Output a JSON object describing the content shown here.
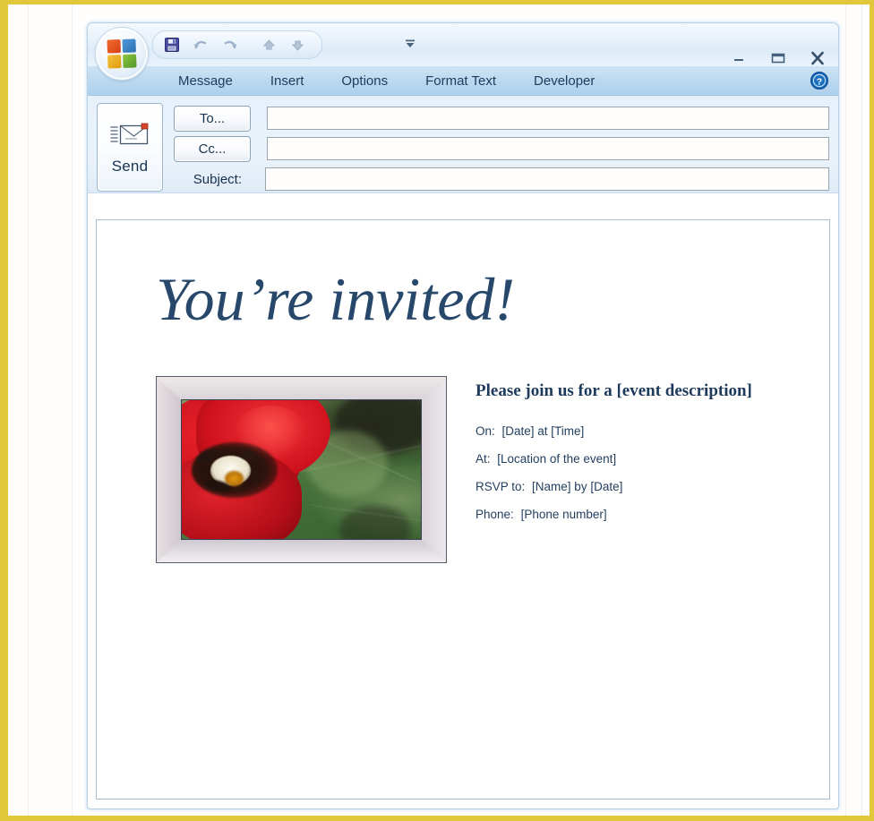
{
  "window": {
    "orb_icon": "office-orb-icon",
    "quick_access": [
      {
        "name": "save-button",
        "icon": "save-floppy-icon",
        "label": "Save"
      },
      {
        "name": "undo-button",
        "icon": "undo-arrow-icon",
        "label": "Undo"
      },
      {
        "name": "redo-button",
        "icon": "redo-arrow-icon",
        "label": "Redo"
      },
      {
        "name": "previous-item-button",
        "icon": "up-arrow-icon",
        "label": "Previous Item"
      },
      {
        "name": "next-item-button",
        "icon": "down-arrow-icon",
        "label": "Next Item"
      }
    ],
    "qat_dropdown_icon": "chevron-down-icon",
    "controls": [
      {
        "name": "minimize-button",
        "icon": "minimize-icon",
        "label": "Minimize"
      },
      {
        "name": "maximize-button",
        "icon": "maximize-icon",
        "label": "Maximize"
      },
      {
        "name": "close-button",
        "icon": "close-icon",
        "label": "Close"
      }
    ]
  },
  "ribbon": {
    "tabs": [
      {
        "label": "Message"
      },
      {
        "label": "Insert"
      },
      {
        "label": "Options"
      },
      {
        "label": "Format Text"
      },
      {
        "label": "Developer"
      }
    ],
    "active_tab": "Message",
    "help_icon": "help-question-icon"
  },
  "compose": {
    "send_label": "Send",
    "send_icon": "envelope-send-icon",
    "to_label": "To...",
    "cc_label": "Cc...",
    "subject_label": "Subject:",
    "to_value": "",
    "cc_value": "",
    "subject_value": "",
    "to_placeholder": "",
    "cc_placeholder": "",
    "subject_placeholder": ""
  },
  "invitation": {
    "title": "You’re invited!",
    "heading": "Please join us for a [event description]",
    "photo_alt": "red-tulip-photo",
    "details": [
      {
        "label": "On:",
        "value": "[Date] at [Time]"
      },
      {
        "label": "At:",
        "value": "[Location of the event]"
      },
      {
        "label": "RSVP to:",
        "value": "[Name] by [Date]"
      },
      {
        "label": "Phone:",
        "value": "[Phone number]"
      }
    ]
  },
  "page": {
    "watermark": "",
    "border_color": "#e3c73b",
    "title_color": "#27486b",
    "accent_color": "#1d3a5b"
  }
}
